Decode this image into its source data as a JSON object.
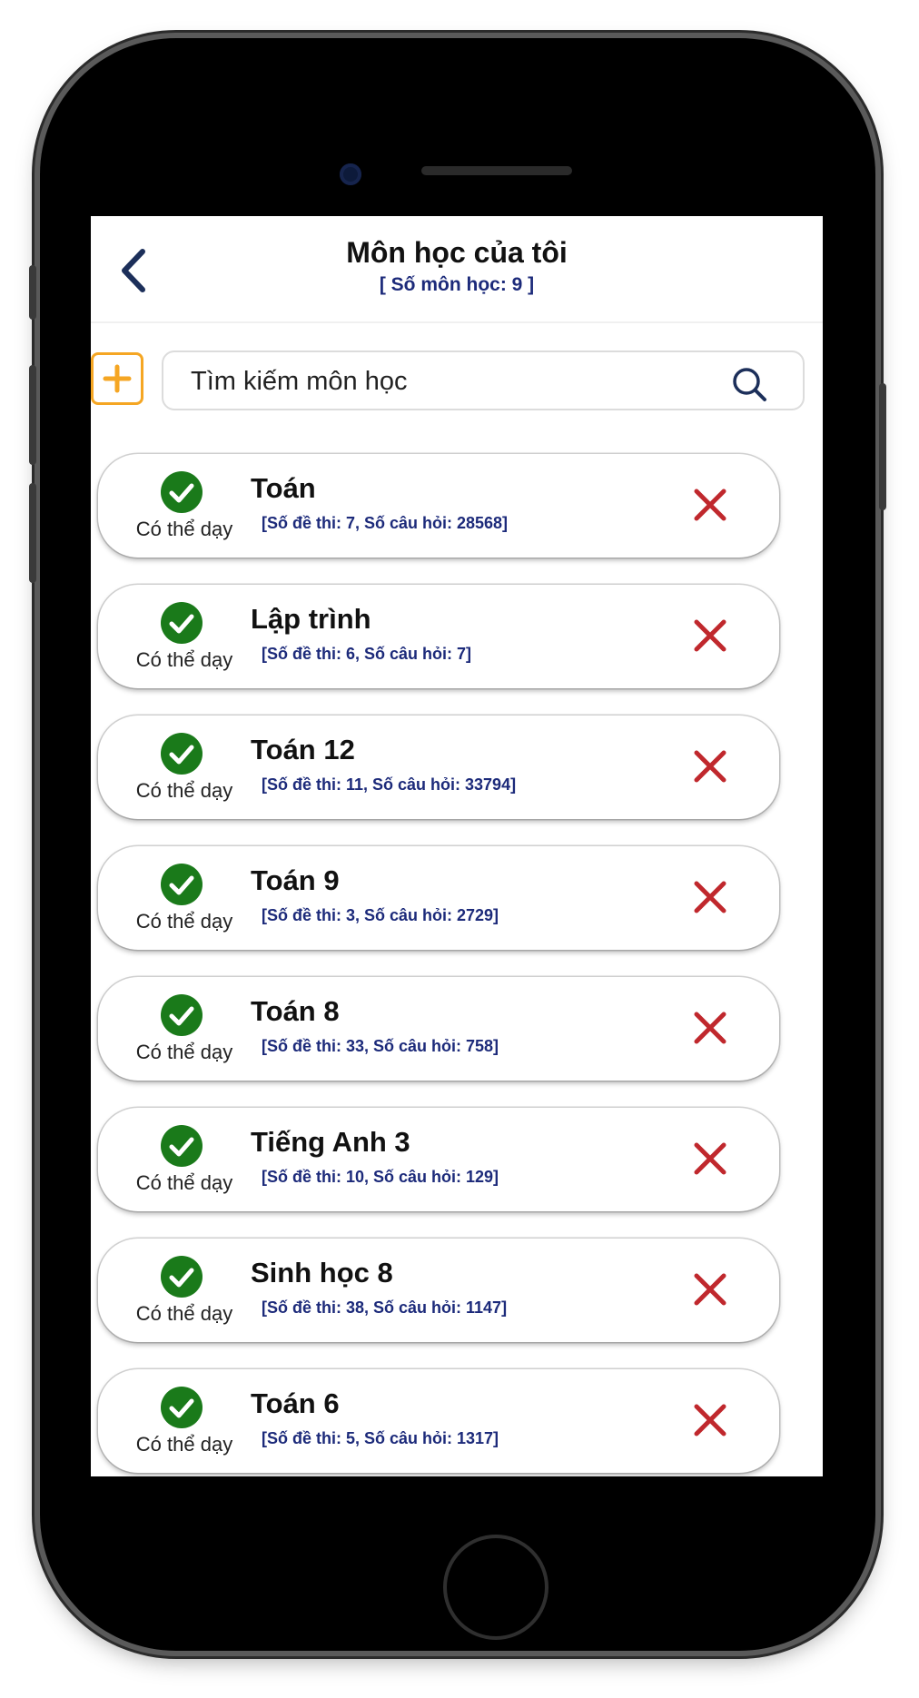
{
  "header": {
    "title": "Môn học của tôi",
    "subtitle": "[ Số môn học: 9 ]"
  },
  "search": {
    "placeholder": "Tìm kiếm môn học",
    "value": ""
  },
  "colors": {
    "accent_orange": "#f5a623",
    "check_green": "#1a7a1a",
    "remove_red": "#c0282d",
    "stats_blue": "#1c2a7a",
    "back_navy": "#1c2f5a"
  },
  "icons": {
    "back": "chevron-left-icon",
    "add": "plus-icon",
    "search": "search-icon",
    "status": "check-circle-icon",
    "remove": "close-icon"
  },
  "subjects": [
    {
      "name": "Toán",
      "status": "Có thể dạy",
      "stats": "[Số đề thi: 7, Số câu hỏi: 28568]"
    },
    {
      "name": "Lập trình",
      "status": "Có thể dạy",
      "stats": "[Số đề thi: 6, Số câu hỏi: 7]"
    },
    {
      "name": "Toán 12",
      "status": "Có thể dạy",
      "stats": "[Số đề thi: 11, Số câu hỏi: 33794]"
    },
    {
      "name": "Toán 9",
      "status": "Có thể dạy",
      "stats": "[Số đề thi: 3, Số câu hỏi: 2729]"
    },
    {
      "name": "Toán 8",
      "status": "Có thể dạy",
      "stats": "[Số đề thi: 33, Số câu hỏi: 758]"
    },
    {
      "name": "Tiếng Anh 3",
      "status": "Có thể dạy",
      "stats": "[Số đề thi: 10, Số câu hỏi: 129]"
    },
    {
      "name": "Sinh học 8",
      "status": "Có thể dạy",
      "stats": "[Số đề thi: 38, Số câu hỏi: 1147]"
    },
    {
      "name": "Toán 6",
      "status": "Có thể dạy",
      "stats": "[Số đề thi: 5, Số câu hỏi: 1317]"
    }
  ]
}
